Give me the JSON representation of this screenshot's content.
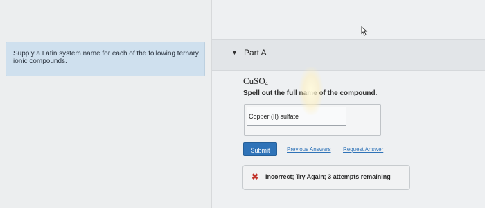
{
  "left_panel": {
    "intro_text": "Supply a Latin system name for each of the following ternary ionic compounds."
  },
  "part": {
    "caret": "▼",
    "title": "Part A"
  },
  "question": {
    "formula_main": "CuSO",
    "formula_sub": "4",
    "instruction": "Spell out the full name of the compound."
  },
  "answer": {
    "value": "Copper (II) sulfate"
  },
  "actions": {
    "submit_label": "Submit",
    "previous_answers_label": "Previous Answers",
    "request_answer_label": "Request Answer"
  },
  "feedback": {
    "icon": "x-icon",
    "text": "Incorrect; Try Again; 3 attempts remaining",
    "color": "#c2332a"
  }
}
